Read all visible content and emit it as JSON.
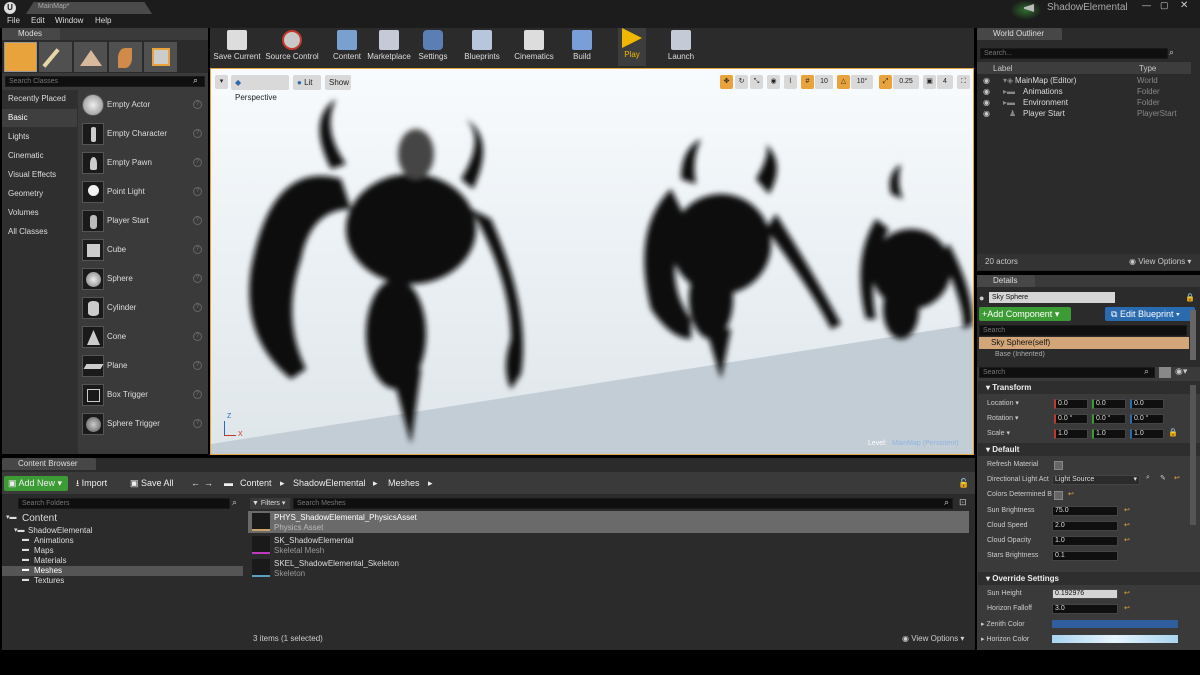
{
  "window": {
    "tab_title": "MainMap*",
    "project": "ShadowElemental"
  },
  "menu": [
    "File",
    "Edit",
    "Window",
    "Help"
  ],
  "modes": {
    "tab": "Modes",
    "search_placeholder": "Search Classes",
    "categories": [
      "Recently Placed",
      "Basic",
      "Lights",
      "Cinematic",
      "Visual Effects",
      "Geometry",
      "Volumes",
      "All Classes"
    ],
    "actors": [
      "Empty Actor",
      "Empty Character",
      "Empty Pawn",
      "Point Light",
      "Player Start",
      "Cube",
      "Sphere",
      "Cylinder",
      "Cone",
      "Plane",
      "Box Trigger",
      "Sphere Trigger"
    ]
  },
  "toolbar": {
    "buttons": [
      "Save Current",
      "Source Control",
      "Content",
      "Marketplace",
      "Settings",
      "Blueprints",
      "Cinematics",
      "Build",
      "Play",
      "Launch"
    ]
  },
  "viewport": {
    "perspective": "Perspective",
    "lit": "Lit",
    "show": "Show",
    "grid_snap": "10",
    "rot_snap": "10°",
    "scale_snap": "0.25",
    "camera_speed": "4",
    "level_label": "Level:",
    "level_name": "MainMap (Persistent)",
    "axis_z": "Z",
    "axis_x": "X"
  },
  "outliner": {
    "tab": "World Outliner",
    "search_placeholder": "Search...",
    "col_label": "Label",
    "col_type": "Type",
    "rows": [
      {
        "label": "MainMap (Editor)",
        "type": "World"
      },
      {
        "label": "Animations",
        "type": "Folder"
      },
      {
        "label": "Environment",
        "type": "Folder"
      },
      {
        "label": "Player Start",
        "type": "PlayerStart"
      }
    ],
    "count": "20 actors",
    "view_options": "View Options"
  },
  "details": {
    "tab": "Details",
    "object_name": "Sky Sphere",
    "add_component": "+Add Component",
    "edit_blueprint": "Edit Blueprint",
    "search_placeholder": "Search",
    "self_row": "Sky Sphere(self)",
    "base_row": "Base (Inherited)",
    "transform": {
      "header": "Transform",
      "location_label": "Location",
      "location": [
        "0.0",
        "0.0",
        "0.0"
      ],
      "rotation_label": "Rotation",
      "rotation": [
        "0.0 °",
        "0.0 °",
        "0.0 °"
      ],
      "scale_label": "Scale",
      "scale": [
        "1.0",
        "1.0",
        "1.0"
      ]
    },
    "default": {
      "header": "Default",
      "refresh_material": "Refresh Material",
      "directional_light": "Directional Light Act",
      "directional_light_value": "Light Source",
      "colors_determined": "Colors Determined B",
      "sun_brightness_label": "Sun Brightness",
      "sun_brightness": "75.0",
      "cloud_speed_label": "Cloud Speed",
      "cloud_speed": "2.0",
      "cloud_opacity_label": "Cloud Opacity",
      "cloud_opacity": "1.0",
      "stars_brightness_label": "Stars Brightness",
      "stars_brightness": "0.1"
    },
    "override": {
      "header": "Override Settings",
      "sun_height_label": "Sun Height",
      "sun_height": "0.192976",
      "horizon_falloff_label": "Horizon Falloff",
      "horizon_falloff": "3.0",
      "zenith_color_label": "Zenith Color",
      "horizon_color_label": "Horizon Color"
    }
  },
  "content_browser": {
    "tab": "Content Browser",
    "add_new": "Add New",
    "import": "Import",
    "save_all": "Save All",
    "path": [
      "Content",
      "ShadowElemental",
      "Meshes"
    ],
    "search_folders": "Search Folders",
    "filters": "Filters",
    "search_assets": "Search Meshes",
    "tree": [
      {
        "name": "Content",
        "level": 0
      },
      {
        "name": "ShadowElemental",
        "level": 1
      },
      {
        "name": "Animations",
        "level": 2
      },
      {
        "name": "Maps",
        "level": 2
      },
      {
        "name": "Materials",
        "level": 2
      },
      {
        "name": "Meshes",
        "level": 2
      },
      {
        "name": "Textures",
        "level": 2
      }
    ],
    "assets": [
      {
        "name": "PHYS_ShadowElemental_PhysicsAsset",
        "type": "Physics Asset"
      },
      {
        "name": "SK_ShadowElemental",
        "type": "Skeletal Mesh"
      },
      {
        "name": "SKEL_ShadowElemental_Skeleton",
        "type": "Skeleton"
      }
    ],
    "status": "3 items (1 selected)",
    "view_options": "View Options"
  },
  "colors": {
    "accent_orange": "#e8a33c",
    "add_green": "#3d9b35",
    "blueprint_blue": "#2a6bb0",
    "play_yellow": "#f0b800",
    "zenith": "#2f5d9e",
    "horizon": "#a9d4f0"
  }
}
